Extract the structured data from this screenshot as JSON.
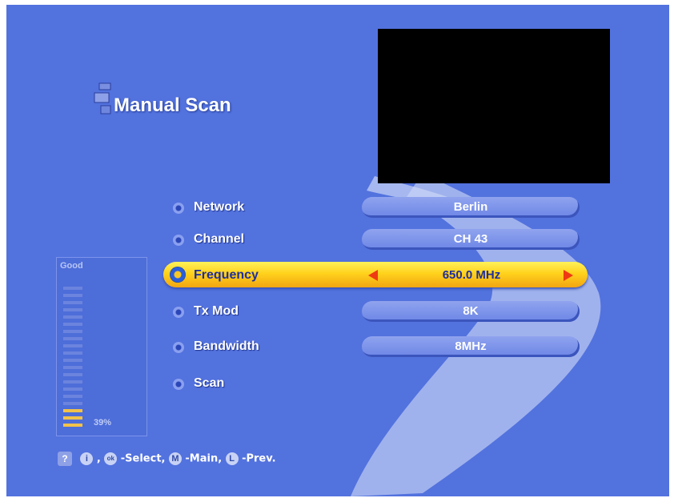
{
  "screen": {
    "title": "Manual Scan"
  },
  "menu": {
    "items": [
      {
        "label": "Network",
        "value": "Berlin"
      },
      {
        "label": "Channel",
        "value": "CH 43"
      },
      {
        "label": "Frequency",
        "value": "650.0 MHz",
        "selected": true
      },
      {
        "label": "Tx Mod",
        "value": "8K"
      },
      {
        "label": "Bandwidth",
        "value": "8MHz"
      },
      {
        "label": "Scan",
        "value": ""
      }
    ]
  },
  "signal": {
    "quality_label": "Good",
    "level_text": "39%",
    "level_fraction": 0.39,
    "bar_color": "#f2c24a"
  },
  "hints": {
    "select_key1": "i",
    "select_key2": "ok",
    "select_text": "-Select,",
    "main_key": "M",
    "main_text": "-Main,",
    "prev_key": "L",
    "prev_text": "-Prev."
  },
  "colors": {
    "background": "#5272de",
    "highlight": "#ffd21c",
    "arrow": "#ee3a12"
  }
}
